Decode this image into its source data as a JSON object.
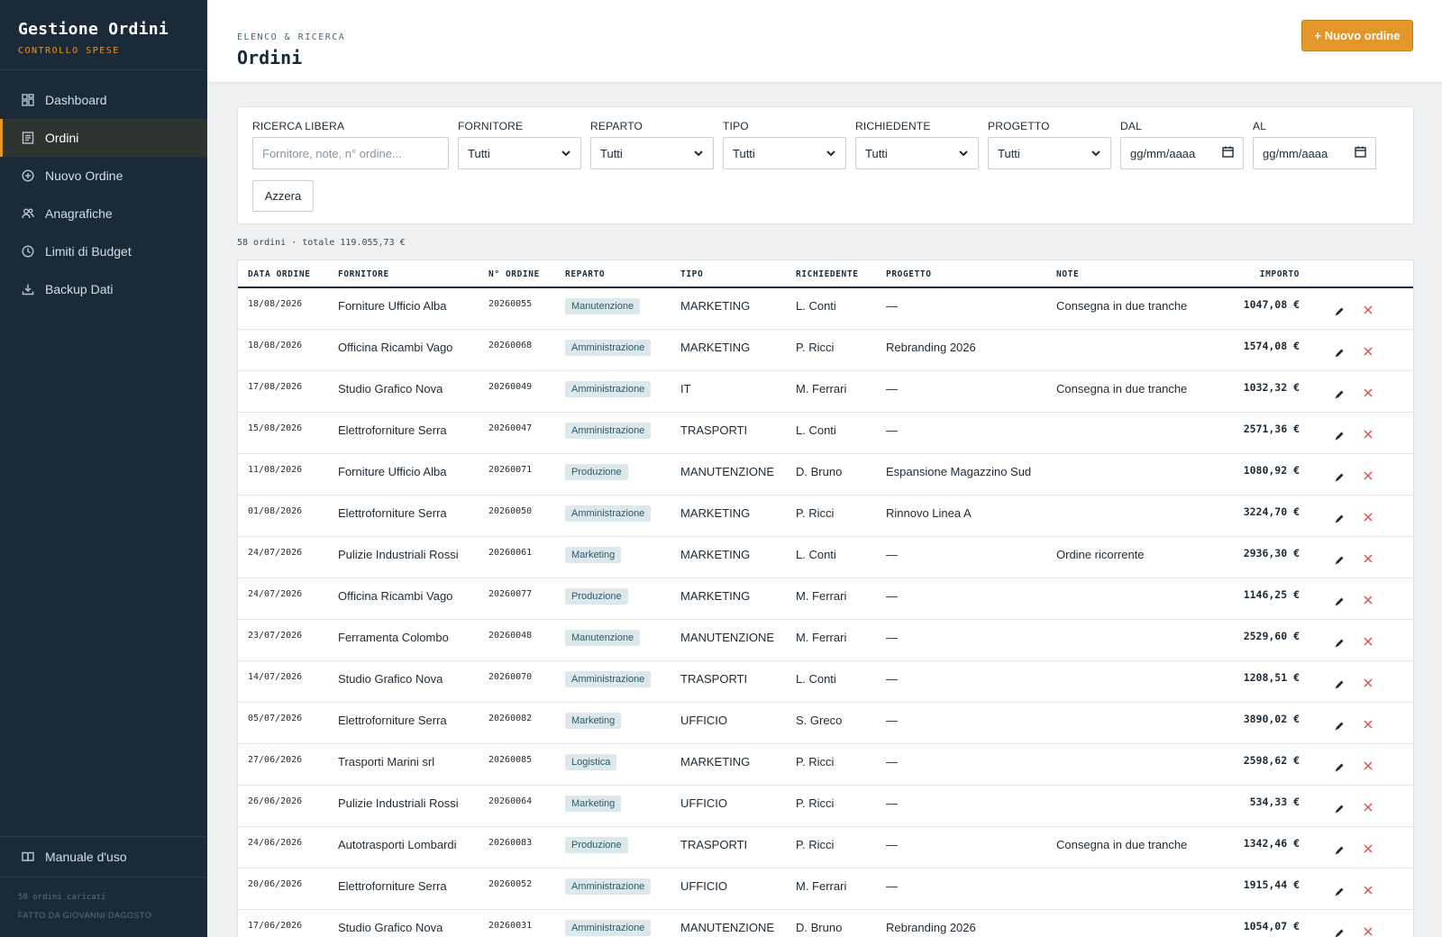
{
  "brand": {
    "title": "Gestione Ordini",
    "subtitle": "CONTROLLO SPESE"
  },
  "sidebar": {
    "items": [
      {
        "label": "Dashboard",
        "icon": "grid-icon"
      },
      {
        "label": "Ordini",
        "icon": "list-icon",
        "active": true
      },
      {
        "label": "Nuovo Ordine",
        "icon": "plus-circle-icon"
      },
      {
        "label": "Anagrafiche",
        "icon": "users-icon"
      },
      {
        "label": "Limiti di Budget",
        "icon": "clock-icon"
      },
      {
        "label": "Backup Dati",
        "icon": "download-icon"
      }
    ],
    "manual": "Manuale d'uso",
    "footer_count": "58 ordini caricati",
    "footer_credit": "FATTO DA GIOVANNI DAGOSTO"
  },
  "header": {
    "breadcrumb": "ELENCO & RICERCA",
    "title": "Ordini",
    "new_button": "+ Nuovo ordine"
  },
  "filters": {
    "search_label": "RICERCA LIBERA",
    "search_placeholder": "Fornitore, note, n° ordine...",
    "fornitore_label": "FORNITORE",
    "fornitore_value": "Tutti",
    "reparto_label": "REPARTO",
    "reparto_value": "Tutti",
    "tipo_label": "TIPO",
    "tipo_value": "Tutti",
    "richiedente_label": "RICHIEDENTE",
    "richiedente_value": "Tutti",
    "progetto_label": "PROGETTO",
    "progetto_value": "Tutti",
    "dal_label": "DAL",
    "dal_value": "gg/mm/aaaa",
    "al_label": "AL",
    "al_value": "gg/mm/aaaa",
    "reset_button": "Azzera"
  },
  "summary": "58 ordini · totale 119.055,73 €",
  "table": {
    "columns": {
      "date": "DATA ORDINE",
      "fornitore": "FORNITORE",
      "numero": "N° ORDINE",
      "reparto": "REPARTO",
      "tipo": "TIPO",
      "richiedente": "RICHIEDENTE",
      "progetto": "PROGETTO",
      "note": "NOTE",
      "importo": "IMPORTO"
    },
    "rows": [
      {
        "date": "18/08/2026",
        "fornitore": "Forniture Ufficio Alba",
        "numero": "20260055",
        "reparto": "Manutenzione",
        "tipo": "MARKETING",
        "richiedente": "L. Conti",
        "progetto": "—",
        "note": "Consegna in due tranche",
        "importo": "1047,08 €"
      },
      {
        "date": "18/08/2026",
        "fornitore": "Officina Ricambi Vago",
        "numero": "20260068",
        "reparto": "Amministrazione",
        "tipo": "MARKETING",
        "richiedente": "P. Ricci",
        "progetto": "Rebranding 2026",
        "note": "",
        "importo": "1574,08 €"
      },
      {
        "date": "17/08/2026",
        "fornitore": "Studio Grafico Nova",
        "numero": "20260049",
        "reparto": "Amministrazione",
        "tipo": "IT",
        "richiedente": "M. Ferrari",
        "progetto": "—",
        "note": "Consegna in due tranche",
        "importo": "1032,32 €"
      },
      {
        "date": "15/08/2026",
        "fornitore": "Elettroforniture Serra",
        "numero": "20260047",
        "reparto": "Amministrazione",
        "tipo": "TRASPORTI",
        "richiedente": "L. Conti",
        "progetto": "—",
        "note": "",
        "importo": "2571,36 €"
      },
      {
        "date": "11/08/2026",
        "fornitore": "Forniture Ufficio Alba",
        "numero": "20260071",
        "reparto": "Produzione",
        "tipo": "MANUTENZIONE",
        "richiedente": "D. Bruno",
        "progetto": "Espansione Magazzino Sud",
        "note": "",
        "importo": "1080,92 €"
      },
      {
        "date": "01/08/2026",
        "fornitore": "Elettroforniture Serra",
        "numero": "20260050",
        "reparto": "Amministrazione",
        "tipo": "MARKETING",
        "richiedente": "P. Ricci",
        "progetto": "Rinnovo Linea A",
        "note": "",
        "importo": "3224,70 €"
      },
      {
        "date": "24/07/2026",
        "fornitore": "Pulizie Industriali Rossi",
        "numero": "20260061",
        "reparto": "Marketing",
        "tipo": "MARKETING",
        "richiedente": "L. Conti",
        "progetto": "—",
        "note": "Ordine ricorrente",
        "importo": "2936,30 €"
      },
      {
        "date": "24/07/2026",
        "fornitore": "Officina Ricambi Vago",
        "numero": "20260077",
        "reparto": "Produzione",
        "tipo": "MARKETING",
        "richiedente": "M. Ferrari",
        "progetto": "—",
        "note": "",
        "importo": "1146,25 €"
      },
      {
        "date": "23/07/2026",
        "fornitore": "Ferramenta Colombo",
        "numero": "20260048",
        "reparto": "Manutenzione",
        "tipo": "MANUTENZIONE",
        "richiedente": "M. Ferrari",
        "progetto": "—",
        "note": "",
        "importo": "2529,60 €"
      },
      {
        "date": "14/07/2026",
        "fornitore": "Studio Grafico Nova",
        "numero": "20260070",
        "reparto": "Amministrazione",
        "tipo": "TRASPORTI",
        "richiedente": "L. Conti",
        "progetto": "—",
        "note": "",
        "importo": "1208,51 €"
      },
      {
        "date": "05/07/2026",
        "fornitore": "Elettroforniture Serra",
        "numero": "20260082",
        "reparto": "Marketing",
        "tipo": "UFFICIO",
        "richiedente": "S. Greco",
        "progetto": "—",
        "note": "",
        "importo": "3890,02 €"
      },
      {
        "date": "27/06/2026",
        "fornitore": "Trasporti Marini srl",
        "numero": "20260085",
        "reparto": "Logistica",
        "tipo": "MARKETING",
        "richiedente": "P. Ricci",
        "progetto": "—",
        "note": "",
        "importo": "2598,62 €"
      },
      {
        "date": "26/06/2026",
        "fornitore": "Pulizie Industriali Rossi",
        "numero": "20260064",
        "reparto": "Marketing",
        "tipo": "UFFICIO",
        "richiedente": "P. Ricci",
        "progetto": "—",
        "note": "",
        "importo": "534,33 €"
      },
      {
        "date": "24/06/2026",
        "fornitore": "Autotrasporti Lombardi",
        "numero": "20260083",
        "reparto": "Produzione",
        "tipo": "TRASPORTI",
        "richiedente": "P. Ricci",
        "progetto": "—",
        "note": "Consegna in due tranche",
        "importo": "1342,46 €"
      },
      {
        "date": "20/06/2026",
        "fornitore": "Elettroforniture Serra",
        "numero": "20260052",
        "reparto": "Amministrazione",
        "tipo": "UFFICIO",
        "richiedente": "M. Ferrari",
        "progetto": "—",
        "note": "",
        "importo": "1915,44 €"
      },
      {
        "date": "17/06/2026",
        "fornitore": "Studio Grafico Nova",
        "numero": "20260031",
        "reparto": "Amministrazione",
        "tipo": "MANUTENZIONE",
        "richiedente": "D. Bruno",
        "progetto": "Rebranding 2026",
        "note": "",
        "importo": "1054,07 €"
      }
    ]
  }
}
